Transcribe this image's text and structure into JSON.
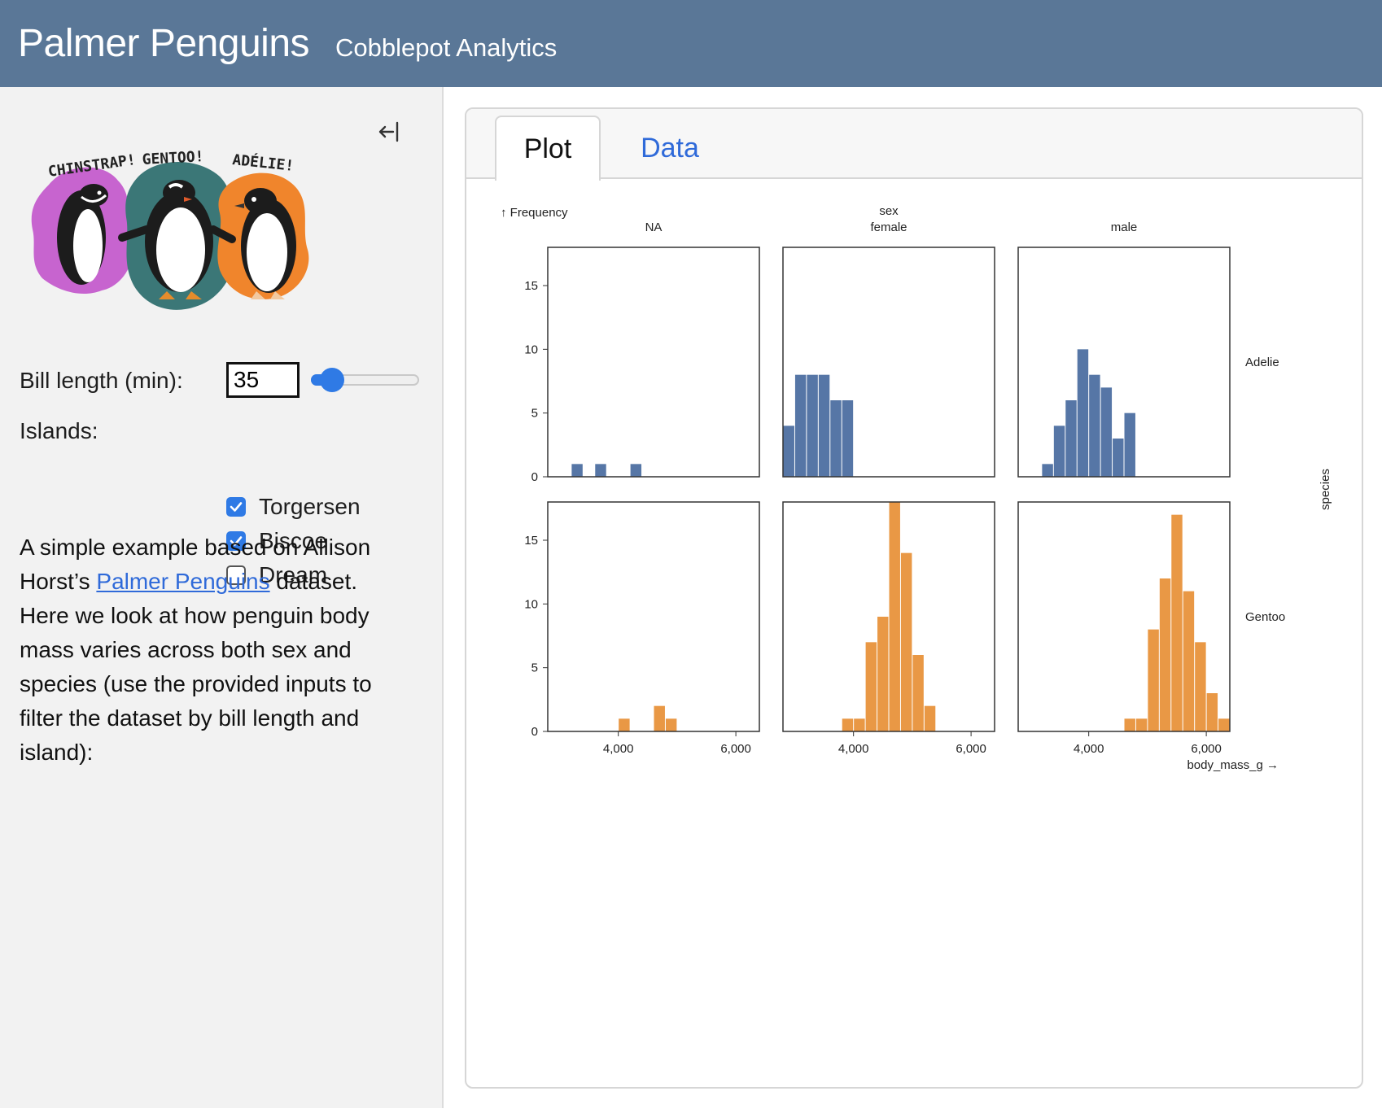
{
  "header": {
    "title": "Palmer Penguins",
    "subtitle": "Cobblepot Analytics"
  },
  "sidebar": {
    "collapse_icon": "collapse-left-icon",
    "art_labels": {
      "chinstrap": "CHINSTRAP!",
      "gentoo": "GENTOO!",
      "adelie": "ADÉLIE!"
    },
    "bill_length": {
      "label": "Bill length (min):",
      "value": "35",
      "slider_min": 32,
      "slider_max": 60,
      "slider_value": 35
    },
    "islands": {
      "label": "Islands:",
      "options": [
        {
          "label": "Torgersen",
          "checked": true
        },
        {
          "label": "Biscoe",
          "checked": true
        },
        {
          "label": "Dream",
          "checked": false
        }
      ]
    },
    "description": {
      "before_link": "A simple example based on Allison Horst’s ",
      "link_text": "Palmer Penguins",
      "after_link": " dataset. Here we look at how penguin body mass varies across both sex and species (use the provided inputs to filter the dataset by bill length and island):"
    }
  },
  "tabs": [
    {
      "label": "Plot",
      "active": true
    },
    {
      "label": "Data",
      "active": false
    }
  ],
  "colors": {
    "adelie": "#5676a6",
    "gentoo": "#e99845",
    "accent": "#2f7ae5",
    "header": "#5a7797"
  },
  "chart_data": {
    "type": "bar",
    "y_axis_label": "↑ Frequency",
    "x_axis_label": "body_mass_g →",
    "column_facet_title": "sex",
    "columns": [
      "NA",
      "female",
      "male"
    ],
    "row_facet_title": "species",
    "rows": [
      "Adelie",
      "Gentoo"
    ],
    "xlim": [
      2800,
      6400
    ],
    "ylim": [
      0,
      18
    ],
    "x_ticks": [
      4000,
      6000
    ],
    "x_tick_labels": [
      "4,000",
      "6,000"
    ],
    "y_ticks": [
      0,
      5,
      10,
      15
    ],
    "bin_width": 200,
    "panels": [
      {
        "species": "Adelie",
        "sex": "NA",
        "bins": [
          [
            3200,
            3400,
            1
          ],
          [
            3600,
            3800,
            1
          ],
          [
            4200,
            4400,
            1
          ]
        ]
      },
      {
        "species": "Adelie",
        "sex": "female",
        "bins": [
          [
            2800,
            3000,
            4
          ],
          [
            3000,
            3200,
            8
          ],
          [
            3200,
            3400,
            8
          ],
          [
            3400,
            3600,
            8
          ],
          [
            3600,
            3800,
            6
          ],
          [
            3800,
            4000,
            6
          ]
        ]
      },
      {
        "species": "Adelie",
        "sex": "male",
        "bins": [
          [
            3200,
            3400,
            1
          ],
          [
            3400,
            3600,
            4
          ],
          [
            3600,
            3800,
            6
          ],
          [
            3800,
            4000,
            10
          ],
          [
            4000,
            4200,
            8
          ],
          [
            4200,
            4400,
            7
          ],
          [
            4400,
            4600,
            3
          ],
          [
            4600,
            4800,
            5
          ]
        ]
      },
      {
        "species": "Gentoo",
        "sex": "NA",
        "bins": [
          [
            4000,
            4200,
            1
          ],
          [
            4600,
            4800,
            2
          ],
          [
            4800,
            5000,
            1
          ]
        ]
      },
      {
        "species": "Gentoo",
        "sex": "female",
        "bins": [
          [
            3800,
            4000,
            1
          ],
          [
            4000,
            4200,
            1
          ],
          [
            4200,
            4400,
            7
          ],
          [
            4400,
            4600,
            9
          ],
          [
            4600,
            4800,
            18
          ],
          [
            4800,
            5000,
            14
          ],
          [
            5000,
            5200,
            6
          ],
          [
            5200,
            5400,
            2
          ]
        ]
      },
      {
        "species": "Gentoo",
        "sex": "male",
        "bins": [
          [
            4600,
            4800,
            1
          ],
          [
            4800,
            5000,
            1
          ],
          [
            5000,
            5200,
            8
          ],
          [
            5200,
            5400,
            12
          ],
          [
            5400,
            5600,
            17
          ],
          [
            5600,
            5800,
            11
          ],
          [
            5800,
            6000,
            7
          ],
          [
            6000,
            6200,
            3
          ],
          [
            6200,
            6400,
            1
          ]
        ]
      }
    ]
  }
}
